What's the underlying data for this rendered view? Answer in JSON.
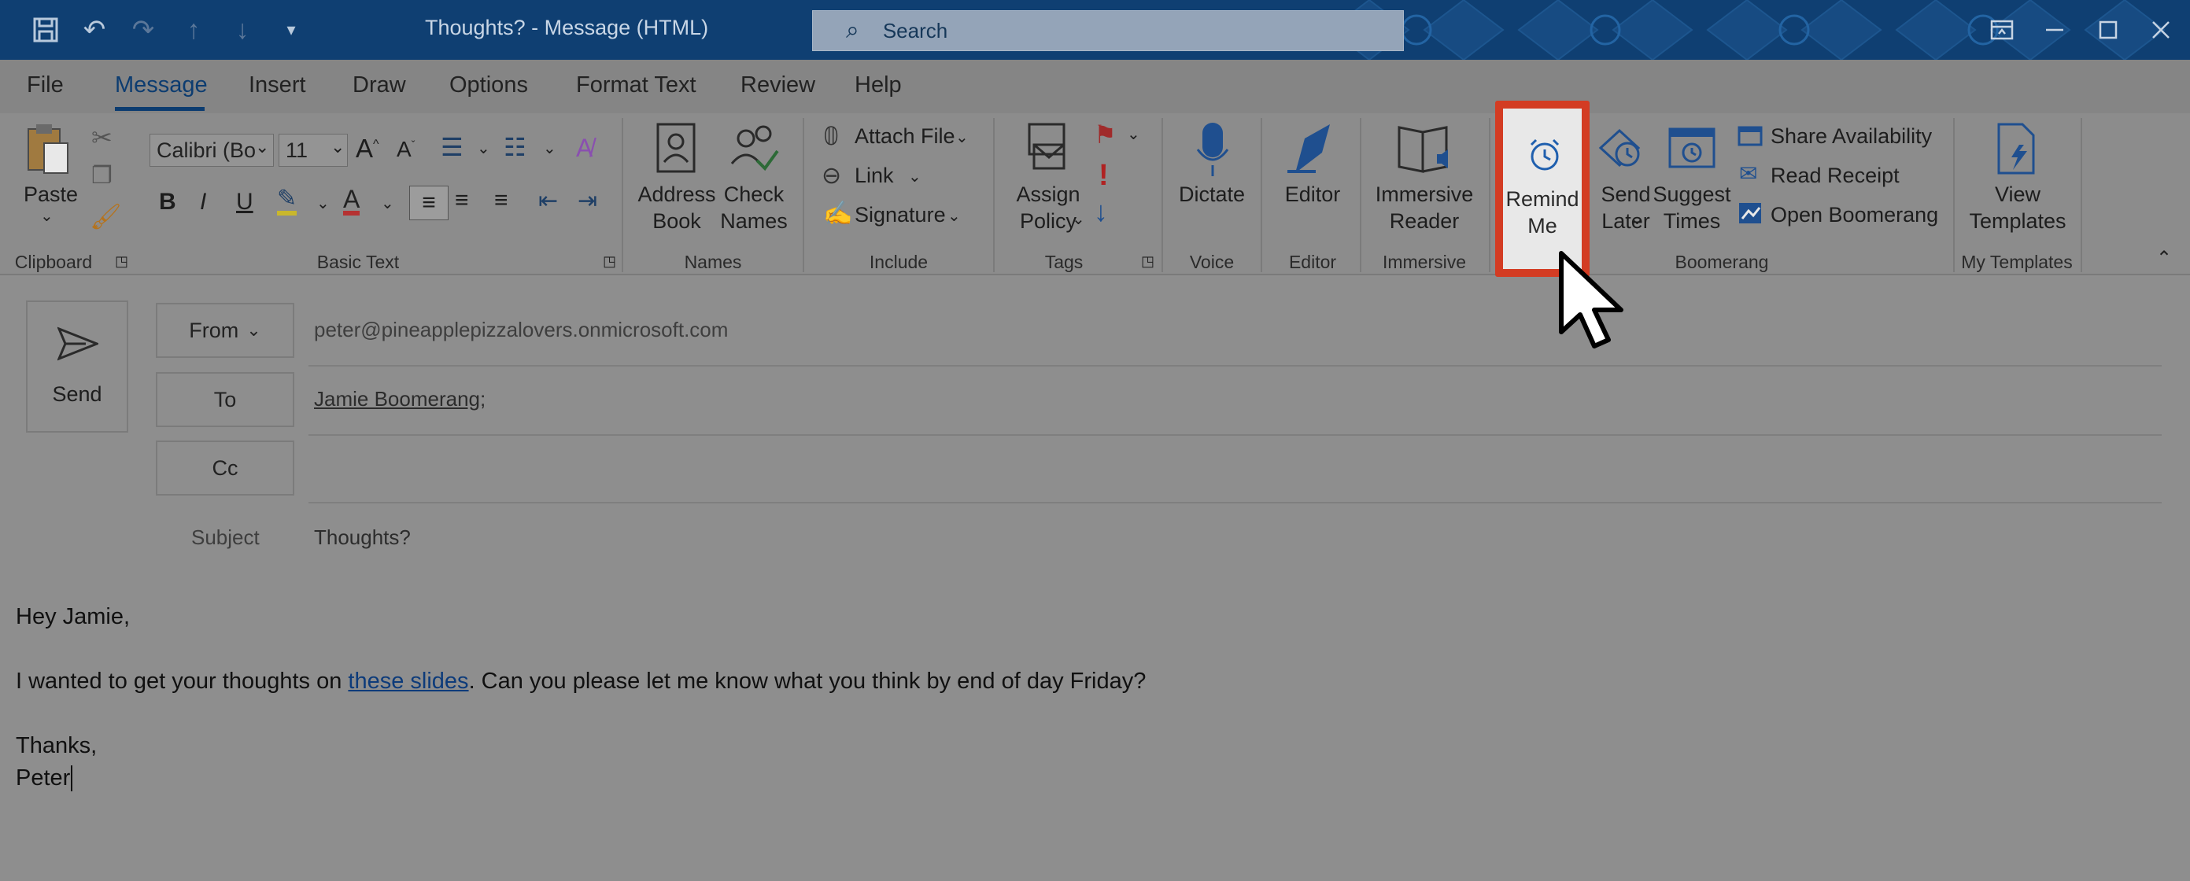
{
  "titlebar": {
    "title": "Thoughts?  -  Message (HTML)",
    "search_placeholder": "Search",
    "icons": [
      "save-icon",
      "undo-icon",
      "redo-icon",
      "up-icon",
      "down-icon",
      "customize-icon"
    ]
  },
  "menu": {
    "file": "File",
    "message": "Message",
    "insert": "Insert",
    "draw": "Draw",
    "options": "Options",
    "format_text": "Format Text",
    "review": "Review",
    "help": "Help"
  },
  "ribbon": {
    "clipboard": {
      "paste": "Paste",
      "label": "Clipboard"
    },
    "basic_text": {
      "font": "Calibri (Bo",
      "size": "11",
      "label": "Basic Text"
    },
    "names": {
      "address_line1": "Address",
      "address_line2": "Book",
      "check_line1": "Check",
      "check_line2": "Names",
      "label": "Names"
    },
    "include": {
      "attach": "Attach File",
      "link": "Link",
      "signature": "Signature",
      "label": "Include"
    },
    "tags": {
      "assign_line1": "Assign",
      "assign_line2": "Policy",
      "label": "Tags"
    },
    "voice": {
      "dictate": "Dictate",
      "label": "Voice"
    },
    "editor": {
      "editor": "Editor",
      "label": "Editor"
    },
    "immersive": {
      "line1": "Immersive",
      "line2": "Reader",
      "label": "Immersive"
    },
    "boomerang": {
      "remind_line1": "Remind",
      "remind_line2": "Me",
      "send_line1": "Send",
      "send_line2": "Later",
      "suggest_line1": "Suggest",
      "suggest_line2": "Times",
      "share": "Share Availability",
      "read": "Read Receipt",
      "open": "Open Boomerang",
      "label": "Boomerang"
    },
    "templates": {
      "line1": "View",
      "line2": "Templates",
      "label": "My Templates"
    }
  },
  "compose": {
    "send_label": "Send",
    "from_label": "From",
    "from_value": "peter@pineapplepizzalovers.onmicrosoft.com",
    "to_label": "To",
    "to_value": "Jamie Boomerang",
    "to_sep": ";",
    "cc_label": "Cc",
    "subject_label": "Subject",
    "subject_value": "Thoughts?",
    "body": {
      "greeting": "Hey Jamie,",
      "line_before": "I wanted to get your thoughts on ",
      "link": "these slides",
      "line_after": ". Can you please let me know what you think by end of day Friday?",
      "thanks": "Thanks,",
      "name": "Peter"
    }
  },
  "colors": {
    "titlebar": "#0f3f72",
    "highlight": "#d33c23",
    "accent": "#0c3c70"
  }
}
